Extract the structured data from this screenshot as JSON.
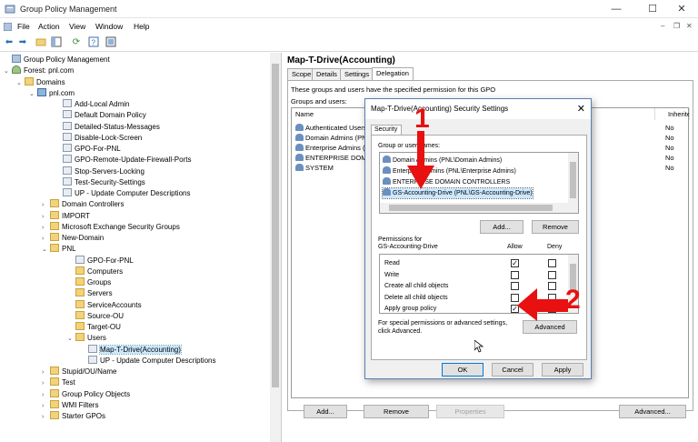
{
  "window": {
    "title": "Group Policy Management",
    "minimize": "—",
    "maximize": "☐",
    "close": "✕"
  },
  "menu": {
    "items": [
      "File",
      "Action",
      "View",
      "Window",
      "Help"
    ]
  },
  "tree": {
    "rows": [
      {
        "label": "Group Policy Management",
        "exp": "",
        "icon": "gpm"
      },
      {
        "label": "Forest: pnl.com",
        "exp": "⌄",
        "icon": "forest"
      },
      {
        "label": "Domains",
        "exp": "⌄",
        "icon": "ou"
      },
      {
        "label": "pnl.com",
        "exp": "⌄",
        "icon": "dom"
      },
      {
        "label": "Add-Local Admin",
        "exp": "",
        "icon": "gpo"
      },
      {
        "label": "Default Domain Policy",
        "exp": "",
        "icon": "gpo"
      },
      {
        "label": "Detailed-Status-Messages",
        "exp": "",
        "icon": "gpo"
      },
      {
        "label": "Disable-Lock-Screen",
        "exp": "",
        "icon": "gpo"
      },
      {
        "label": "GPO-For-PNL",
        "exp": "",
        "icon": "gpo"
      },
      {
        "label": "GPO-Remote-Update-Firewall-Ports",
        "exp": "",
        "icon": "gpo"
      },
      {
        "label": "Stop-Servers-Locking",
        "exp": "",
        "icon": "gpo"
      },
      {
        "label": "Test-Security-Settings",
        "exp": "",
        "icon": "gpo"
      },
      {
        "label": "UP - Update Computer Descriptions",
        "exp": "",
        "icon": "gpo"
      },
      {
        "label": "Domain Controllers",
        "exp": "›",
        "icon": "ou"
      },
      {
        "label": "IMPORT",
        "exp": "›",
        "icon": "ou"
      },
      {
        "label": "Microsoft Exchange Security Groups",
        "exp": "›",
        "icon": "ou"
      },
      {
        "label": "New-Domain",
        "exp": "›",
        "icon": "ou"
      },
      {
        "label": "PNL",
        "exp": "⌄",
        "icon": "ou"
      },
      {
        "label": "GPO-For-PNL",
        "exp": "",
        "icon": "gpo"
      },
      {
        "label": "Computers",
        "exp": "",
        "icon": "ou"
      },
      {
        "label": "Groups",
        "exp": "",
        "icon": "ou"
      },
      {
        "label": "Servers",
        "exp": "",
        "icon": "ou"
      },
      {
        "label": "ServiceAccounts",
        "exp": "",
        "icon": "ou"
      },
      {
        "label": "Source-OU",
        "exp": "",
        "icon": "ou"
      },
      {
        "label": "Target-OU",
        "exp": "",
        "icon": "ou"
      },
      {
        "label": "Users",
        "exp": "⌄",
        "icon": "ou"
      },
      {
        "label": "Map-T-Drive(Accounting)",
        "exp": "",
        "icon": "gpo"
      },
      {
        "label": "UP - Update Computer Descriptions",
        "exp": "",
        "icon": "gpo"
      },
      {
        "label": "Stupid/OU/Name",
        "exp": "›",
        "icon": "ou"
      },
      {
        "label": "Test",
        "exp": "›",
        "icon": "ou"
      },
      {
        "label": "Group Policy Objects",
        "exp": "›",
        "icon": "ou"
      },
      {
        "label": "WMI Filters",
        "exp": "›",
        "icon": "ou"
      },
      {
        "label": "Starter GPOs",
        "exp": "›",
        "icon": "ou"
      }
    ],
    "selected_index": 26
  },
  "details": {
    "title": "Map-T-Drive(Accounting)",
    "tabs": [
      "Scope",
      "Details",
      "Settings",
      "Delegation"
    ],
    "active_tab": "Delegation",
    "description": "These groups and users have the specified permission for this GPO",
    "groups_label": "Groups and users:",
    "columns": [
      "Name",
      "Inherited"
    ],
    "col_inherited_short": "Inherited",
    "rows": [
      {
        "name": "Authenticated Users",
        "inherited": "No"
      },
      {
        "name": "Domain Admins (PNL\\Domain Admins)",
        "inherited": "No"
      },
      {
        "name": "Enterprise Admins (PNL\\Enterprise Admins)",
        "inherited": "No"
      },
      {
        "name": "ENTERPRISE DOMAIN CONTROLLERS",
        "inherited": "No"
      },
      {
        "name": "SYSTEM",
        "inherited": "No"
      }
    ],
    "buttons": {
      "add": "Add...",
      "remove": "Remove",
      "properties": "Properties",
      "advanced": "Advanced..."
    }
  },
  "dialog": {
    "title": "Map-T-Drive(Accounting) Security Settings",
    "tab": "Security",
    "group_label": "Group or user names:",
    "groups": [
      "Domain Admins (PNL\\Domain Admins)",
      "Enterprise Admins (PNL\\Enterprise Admins)",
      "ENTERPRISE DOMAIN CONTROLLERS",
      "GS-Accounting-Drive (PNL\\GS-Accounting-Drive)"
    ],
    "selected_group": 3,
    "add": "Add...",
    "remove": "Remove",
    "perm_label_1": "Permissions for",
    "perm_label_2": "GS-Accounting-Drive",
    "allow": "Allow",
    "deny": "Deny",
    "permissions": [
      {
        "name": "Read",
        "allow": true,
        "deny": false
      },
      {
        "name": "Write",
        "allow": false,
        "deny": false
      },
      {
        "name": "Create all child objects",
        "allow": false,
        "deny": false
      },
      {
        "name": "Delete all child objects",
        "allow": false,
        "deny": false
      },
      {
        "name": "Apply group policy",
        "allow": true,
        "deny": false
      }
    ],
    "special_1": "For special permissions or advanced settings,",
    "special_2": "click Advanced.",
    "advanced": "Advanced",
    "ok": "OK",
    "cancel": "Cancel",
    "apply": "Apply"
  },
  "annotations": {
    "step1": "1",
    "step2": "2",
    "color": "#e81010"
  }
}
